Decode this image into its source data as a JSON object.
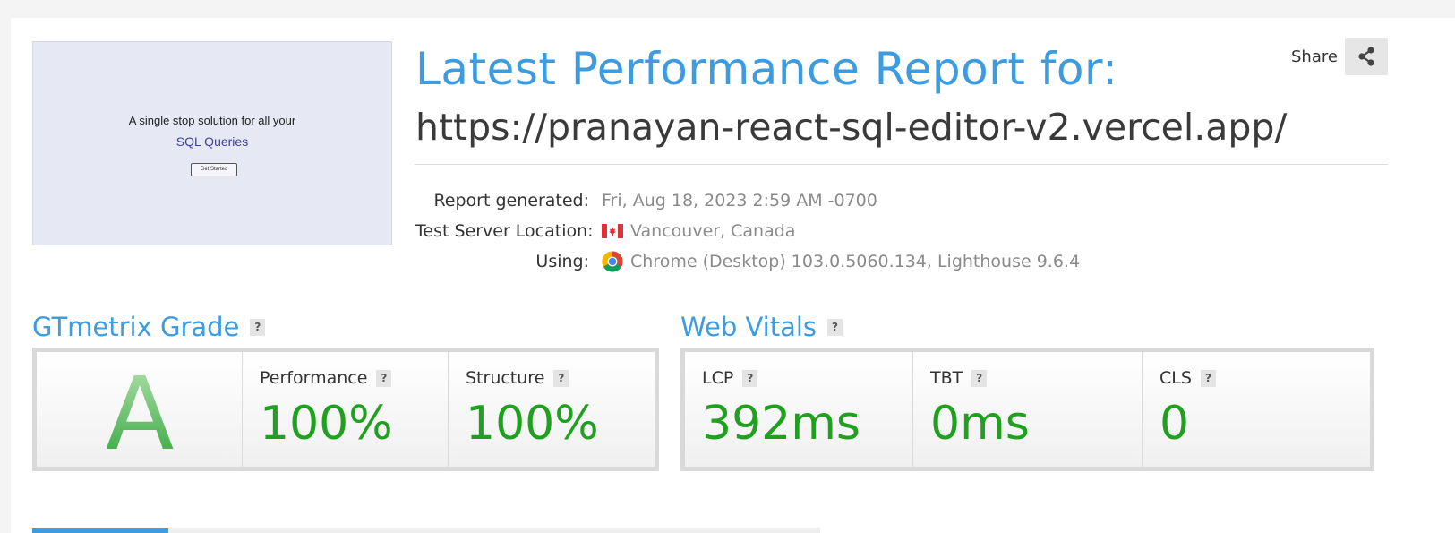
{
  "thumbnail": {
    "line1": "A single stop solution for all your",
    "line2": "SQL Queries",
    "button": "Get Started"
  },
  "header": {
    "title": "Latest Performance Report for:",
    "url": "https://pranayan-react-sql-editor-v2.vercel.app/",
    "share_label": "Share"
  },
  "meta": {
    "report_generated_label": "Report generated:",
    "report_generated_value": "Fri, Aug 18, 2023 2:59 AM -0700",
    "location_label": "Test Server Location:",
    "location_value": "Vancouver, Canada",
    "using_label": "Using:",
    "using_value": "Chrome (Desktop) 103.0.5060.134, Lighthouse 9.6.4"
  },
  "grade": {
    "title": "GTmetrix Grade",
    "help": "?",
    "letter": "A",
    "performance_label": "Performance",
    "performance_value": "100%",
    "structure_label": "Structure",
    "structure_value": "100%"
  },
  "vitals": {
    "title": "Web Vitals",
    "help": "?",
    "lcp_label": "LCP",
    "lcp_value": "392ms",
    "tbt_label": "TBT",
    "tbt_value": "0ms",
    "cls_label": "CLS",
    "cls_value": "0"
  },
  "colors": {
    "accent": "#3d9be0",
    "good": "#1fa11f"
  },
  "icons": {
    "share": "share-icon",
    "flag": "canada-flag-icon",
    "browser": "chrome-icon"
  }
}
